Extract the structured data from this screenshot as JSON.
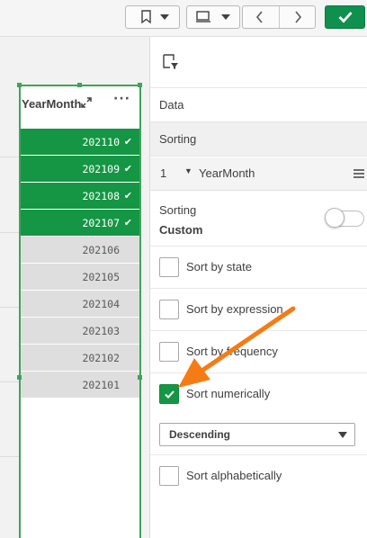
{
  "toolbar": {
    "bookmark_icon": "bookmark-icon",
    "sheet_icon": "sheet-icon",
    "prev_icon": "chevron-left-icon",
    "next_icon": "chevron-right-icon",
    "done_icon": "checkmark-icon",
    "accent": "#10904e"
  },
  "listbox": {
    "title": "YearMonth",
    "more_label": "···",
    "rows": [
      {
        "value": "202110",
        "state": "selected"
      },
      {
        "value": "202109",
        "state": "selected"
      },
      {
        "value": "202108",
        "state": "selected"
      },
      {
        "value": "202107",
        "state": "selected"
      },
      {
        "value": "202106",
        "state": "excluded"
      },
      {
        "value": "202105",
        "state": "excluded"
      },
      {
        "value": "202104",
        "state": "excluded"
      },
      {
        "value": "202103",
        "state": "excluded"
      },
      {
        "value": "202102",
        "state": "excluded"
      },
      {
        "value": "202101",
        "state": "excluded"
      }
    ],
    "selected_color": "#159644",
    "excluded_color": "#dedede"
  },
  "panel": {
    "header_icon": "properties-filter-icon",
    "tabs": [
      {
        "label": "Data"
      },
      {
        "label": "Sorting"
      }
    ],
    "sort_field": {
      "index": "1",
      "name": "YearMonth"
    },
    "sorting_label": "Sorting",
    "sorting_mode": "Custom",
    "options": [
      {
        "label": "Sort by state",
        "checked": false
      },
      {
        "label": "Sort by expression",
        "checked": false
      },
      {
        "label": "Sort by frequency",
        "checked": false
      },
      {
        "label": "Sort numerically",
        "checked": true
      },
      {
        "label": "Sort alphabetically",
        "checked": false
      }
    ],
    "numeric_order": "Descending"
  },
  "annotation": {
    "arrow_color": "#f57c15"
  }
}
